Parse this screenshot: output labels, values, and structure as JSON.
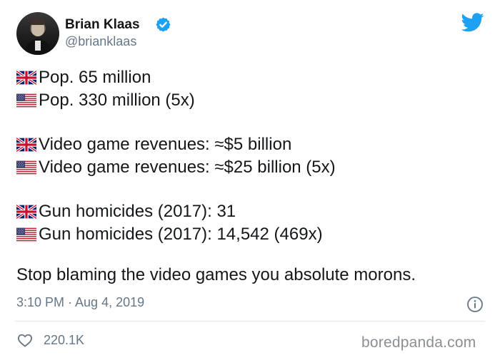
{
  "author": {
    "name": "Brian Klaas",
    "handle": "@brianklaas",
    "verified": true
  },
  "flags": {
    "uk": "uk-flag",
    "us": "us-flag"
  },
  "lines": [
    {
      "flag": "uk",
      "text": "Pop. 65 million"
    },
    {
      "flag": "us",
      "text": "Pop. 330 million (5x)"
    },
    {
      "flag": "uk",
      "text": "Video game revenues: ≈$5 billion"
    },
    {
      "flag": "us",
      "text": "Video game revenues: ≈$25 billion (5x)"
    },
    {
      "flag": "uk",
      "text": "Gun homicides (2017): 31"
    },
    {
      "flag": "us",
      "text": "Gun homicides (2017): 14,542 (469x)"
    }
  ],
  "closing": "Stop blaming the video games you absolute morons.",
  "timestamp": "3:10 PM · Aug 4, 2019",
  "likes": "220.1K",
  "watermark": "boredpanda.com",
  "colors": {
    "twitter_blue": "#1da1f2",
    "text": "#14171a",
    "secondary": "#657786"
  }
}
